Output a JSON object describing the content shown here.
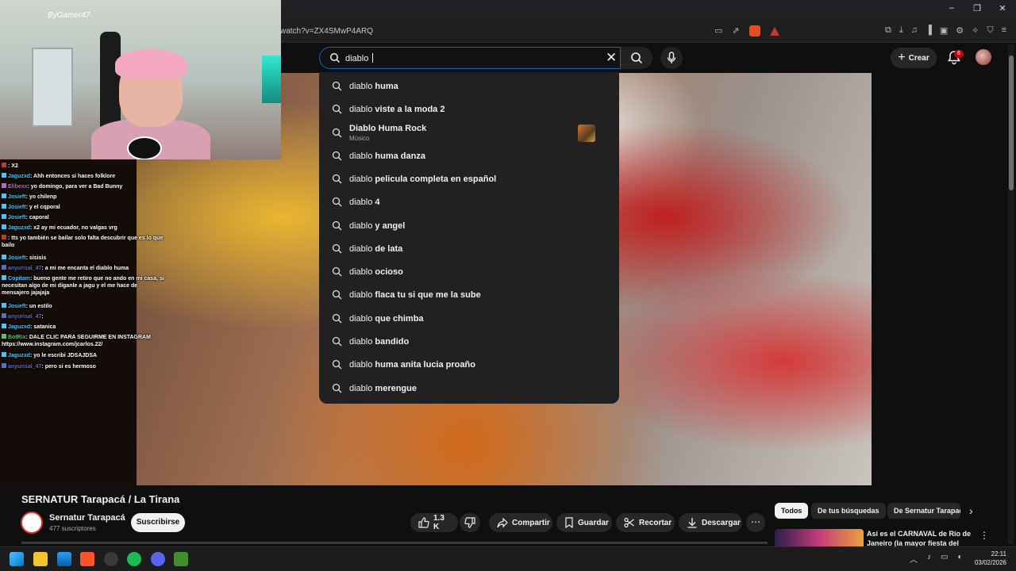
{
  "window": {
    "url": "watch?v=ZX4SMwP4ARQ",
    "controls": [
      "–",
      "❐",
      "✕"
    ]
  },
  "youtube": {
    "search": {
      "value": "diablo "
    },
    "create_label": "Crear",
    "notification_count": "6"
  },
  "suggestions": [
    {
      "prefix": "diablo",
      "rest": " huma"
    },
    {
      "prefix": "diablo",
      "rest": " viste a la moda 2"
    },
    {
      "prefix": "",
      "rest": "Diablo Huma Rock",
      "sub": "Músico"
    },
    {
      "prefix": "diablo",
      "rest": " huma danza"
    },
    {
      "prefix": "diablo",
      "rest": " pelicula completa en español"
    },
    {
      "prefix": "diablo",
      "rest": " 4"
    },
    {
      "prefix": "diablo",
      "rest": " y angel"
    },
    {
      "prefix": "diablo",
      "rest": " de lata"
    },
    {
      "prefix": "diablo",
      "rest": " ocioso"
    },
    {
      "prefix": "diablo",
      "rest": " flaca tu si que me la sube"
    },
    {
      "prefix": "diablo",
      "rest": " que chimba"
    },
    {
      "prefix": "diablo",
      "rest": " bandido"
    },
    {
      "prefix": "diablo",
      "rest": " huma anita lucia proaño"
    },
    {
      "prefix": "diablo",
      "rest": " merengue"
    }
  ],
  "overlay": {
    "logo": "ByGamer47",
    "chat": [
      {
        "user": "",
        "msg": ": X2",
        "color": "#c0392b"
      },
      {
        "user": "Jaguzxd",
        "msg": ": Ahh entonces si haces folklore",
        "color": "#4fc3f7"
      },
      {
        "user": "Elibexx",
        "msg": ": yo domingo, para ver a Bad Bunny",
        "color": "#ba68c8"
      },
      {
        "user": "Josieft",
        "msg": ": yo chilenp",
        "color": "#4fc3f7"
      },
      {
        "user": "Josieft",
        "msg": ": y el cqporal",
        "color": "#4fc3f7"
      },
      {
        "user": "Josieft",
        "msg": ": caporal",
        "color": "#4fc3f7"
      },
      {
        "user": "Jaguzxd",
        "msg": ": x2 ay mi ecuador, no valgas vrg",
        "color": "#4fc3f7"
      },
      {
        "user": "",
        "msg": ": tts yo también se bailar solo falta descubrir que es lo que bailo",
        "color": "#c0392b"
      },
      {
        "user": "Josieft",
        "msg": ": sisisis",
        "color": "#4fc3f7"
      },
      {
        "user": "anyurisal_47",
        "msg": ": a mi me encanta el diablo huma",
        "color": "#5c6bc0"
      },
      {
        "user": "Copitam",
        "msg": ": bueno gente me retiro que no ando en mi casa, si necesitan algo de mi díganle a jagu y el me hace de mensajero jajajaja",
        "color": "#4fc3f7"
      },
      {
        "user": "Josieft",
        "msg": ": un estilo",
        "color": "#4fc3f7"
      },
      {
        "user": "anyurisal_47",
        "msg": ":",
        "color": "#5c6bc0"
      },
      {
        "user": "Jaguzxd",
        "msg": ": satanica",
        "color": "#4fc3f7"
      },
      {
        "user": "BotRix",
        "msg": ": DALE CLIC PARA SEGUIRME EN INSTAGRAM https://www.instagram.com/jcarlos.22/",
        "color": "#66bb6a"
      },
      {
        "user": "Jaguzxd",
        "msg": ": yo le escribi JDSAJDSA",
        "color": "#4fc3f7"
      },
      {
        "user": "anyurisal_47",
        "msg": ": pero si es hermoso",
        "color": "#5c6bc0"
      }
    ]
  },
  "video": {
    "title": "SERNATUR Tarapacá / La Tirana",
    "channel": "Sernatur Tarapacá",
    "subscribers": "477 suscriptores",
    "subscribe_label": "Suscribirse",
    "likes": "1.3 K",
    "share_label": "Compartir",
    "save_label": "Guardar",
    "clip_label": "Recortar",
    "download_label": "Descargar"
  },
  "sidebar": {
    "chips": [
      "Todos",
      "De tus búsquedas",
      "De Sernatur Tarapacá"
    ],
    "related_title": "Así es el CARNAVAL de Río de Janeiro (la mayor fiesta del"
  },
  "taskbar": {
    "time": "22:11",
    "date": "03/02/2026"
  },
  "colors": {
    "search_focus": "#1c62b9",
    "notification_badge": "#cc0000",
    "dropdown_bg": "#212121"
  }
}
